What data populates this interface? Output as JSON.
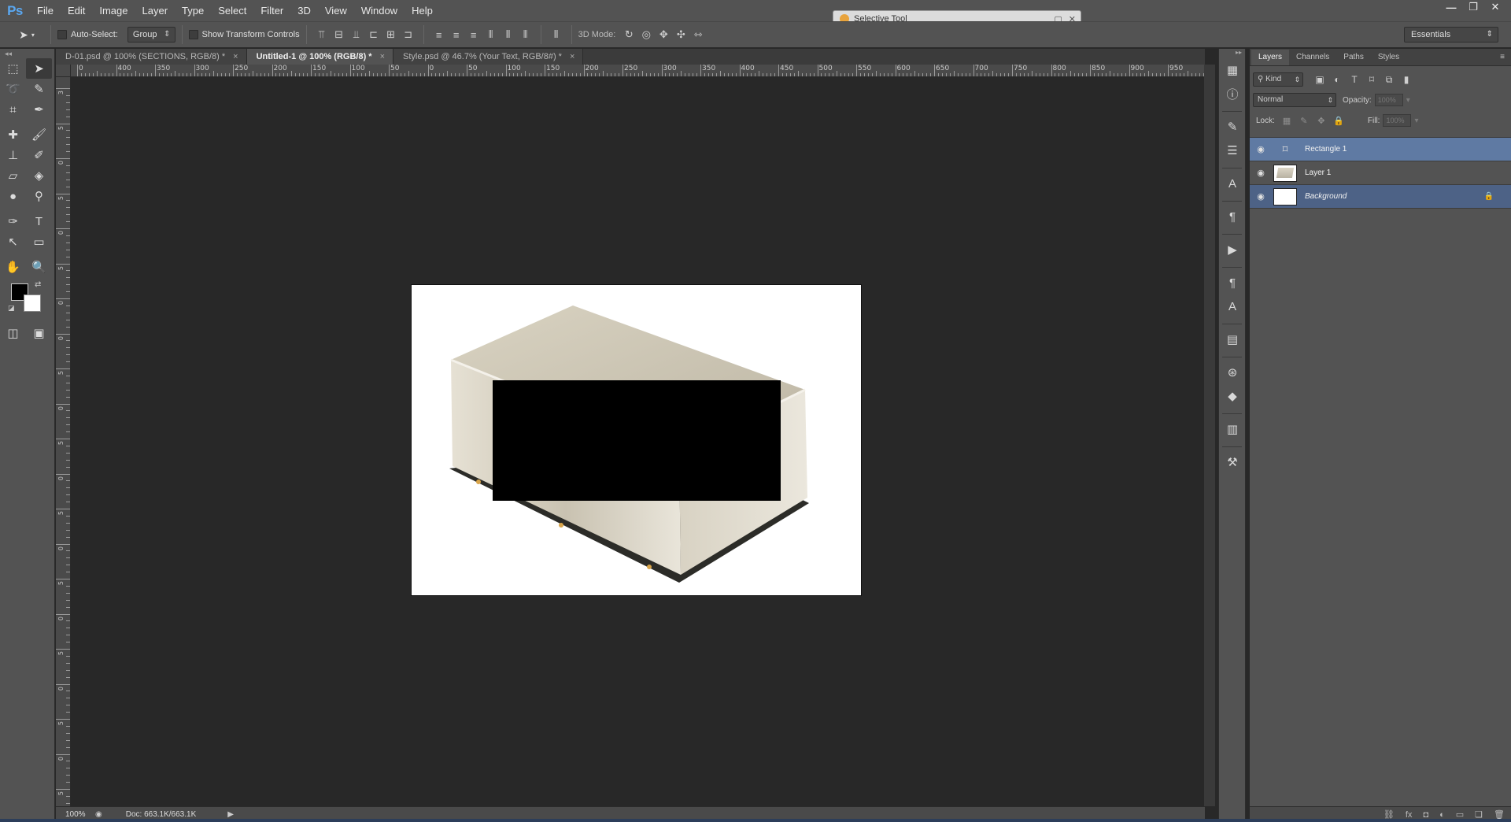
{
  "app": {
    "logo": "Ps"
  },
  "menu": [
    "File",
    "Edit",
    "Image",
    "Layer",
    "Type",
    "Select",
    "Filter",
    "3D",
    "View",
    "Window",
    "Help"
  ],
  "window_controls": [
    "—",
    "❐",
    "✕"
  ],
  "options": {
    "tool_glyph": "➤",
    "auto_select_label": "Auto-Select:",
    "auto_select_mode": "Group",
    "show_transform_label": "Show Transform Controls",
    "mode_3d_label": "3D Mode:",
    "workspace": "Essentials"
  },
  "selective_tool": {
    "title": "Selective Tool",
    "btn1": "▢",
    "btn2": "✕"
  },
  "tabs": [
    {
      "label": "D-01.psd @ 100% (SECTIONS, RGB/8) *",
      "active": false
    },
    {
      "label": "Untitled-1 @ 100% (RGB/8) *",
      "active": true
    },
    {
      "label": "Style.psd @ 46.7% (Your Text, RGB/8#) *",
      "active": false
    }
  ],
  "ruler": {
    "h_labels": [
      "0",
      "400",
      "350",
      "300",
      "250",
      "200",
      "150",
      "100",
      "50",
      "0",
      "50",
      "100",
      "150",
      "200",
      "250",
      "300",
      "350",
      "400",
      "450",
      "500",
      "550",
      "600",
      "650",
      "700",
      "750",
      "800",
      "850",
      "900",
      "950",
      "1"
    ],
    "v_labels": [
      "3",
      "5",
      "0",
      "5",
      "0",
      "5",
      "0",
      "0",
      "5",
      "0",
      "5",
      "0",
      "5",
      "0",
      "5",
      "0",
      "5",
      "0",
      "5",
      "0",
      "5"
    ]
  },
  "status": {
    "zoom": "100%",
    "doc": "Doc: 663.1K/663.1K",
    "arrow": "▶"
  },
  "panel": {
    "tabs": [
      "Layers",
      "Channels",
      "Paths",
      "Styles"
    ],
    "menu_icon": "≡",
    "filter_kind": "Kind",
    "blend_mode": "Normal",
    "opacity_label": "Opacity:",
    "opacity_value": "100%",
    "lock_label": "Lock:",
    "fill_label": "Fill:",
    "fill_value": "100%"
  },
  "layers": [
    {
      "name": "Rectangle 1",
      "kind": "shape",
      "state": "selected"
    },
    {
      "name": "Layer 1",
      "kind": "pixel",
      "state": "normal"
    },
    {
      "name": "Background",
      "kind": "background",
      "state": "bg-selected",
      "locked": true
    }
  ],
  "icons": {
    "eye": "👁",
    "lock": "🔒"
  }
}
